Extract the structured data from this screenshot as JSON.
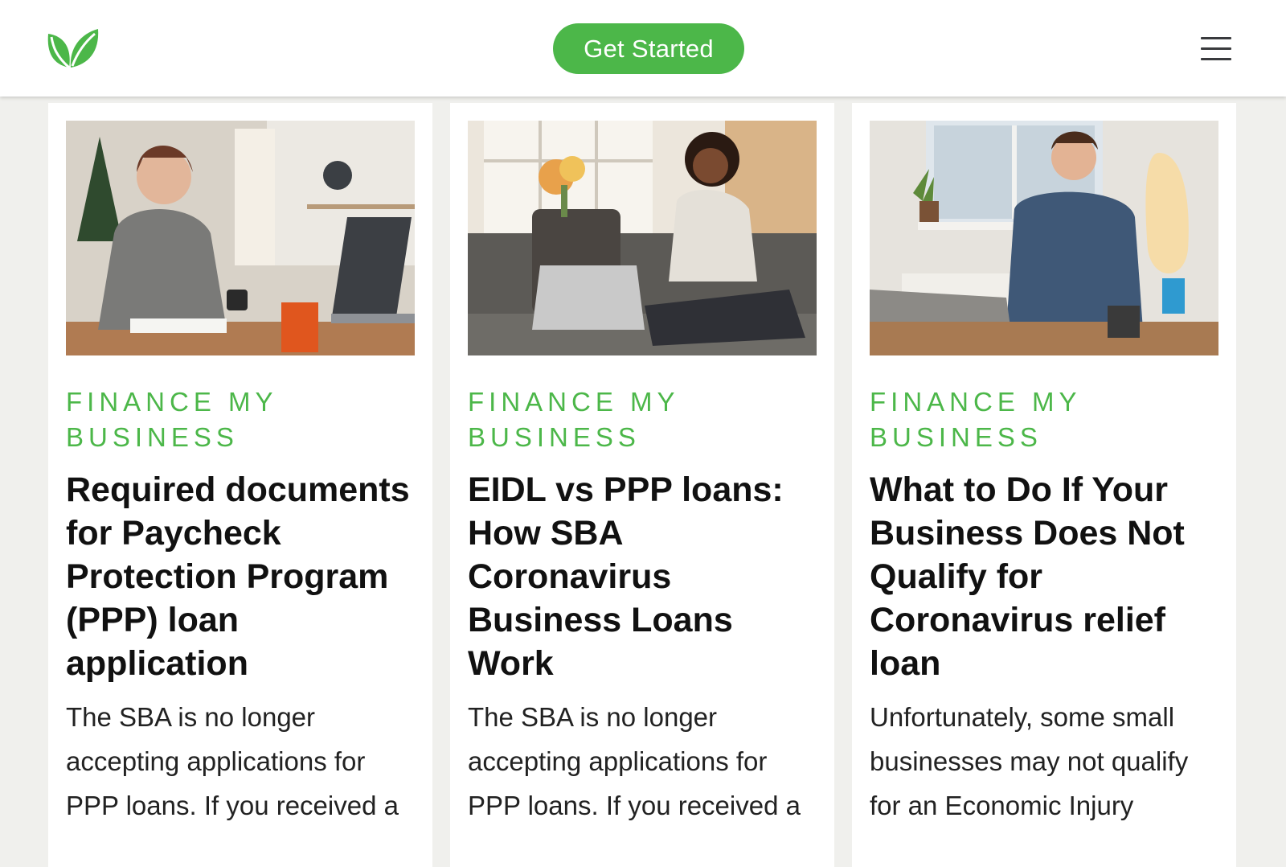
{
  "header": {
    "logo_icon": "leaf-logo-icon",
    "cta_label": "Get Started",
    "menu_icon": "hamburger-menu-icon"
  },
  "colors": {
    "brand_green": "#4cb749",
    "header_bg": "#ffffff",
    "page_bg": "#f0f0ed",
    "title_text": "#111111"
  },
  "cards": [
    {
      "image": "photo-woman-writing-with-phone-and-laptop",
      "category": "FINANCE MY BUSINESS",
      "title": "Required documents for Paycheck Protection Program (PPP) loan application",
      "excerpt": "The SBA is no longer accepting applications for PPP loans. If you received a"
    },
    {
      "image": "photo-woman-on-couch-with-laptop",
      "category": "FINANCE MY BUSINESS",
      "title": "EIDL vs PPP loans: How SBA Coronavirus Business Loans Work",
      "excerpt": "The SBA is no longer accepting applications for PPP loans. If you received a"
    },
    {
      "image": "photo-man-thinking-at-laptop",
      "category": "FINANCE MY BUSINESS",
      "title": "What to Do If Your Business Does Not Qualify for Coronavirus relief loan",
      "excerpt": "Unfortunately, some small businesses may not qualify for an Economic Injury"
    }
  ]
}
